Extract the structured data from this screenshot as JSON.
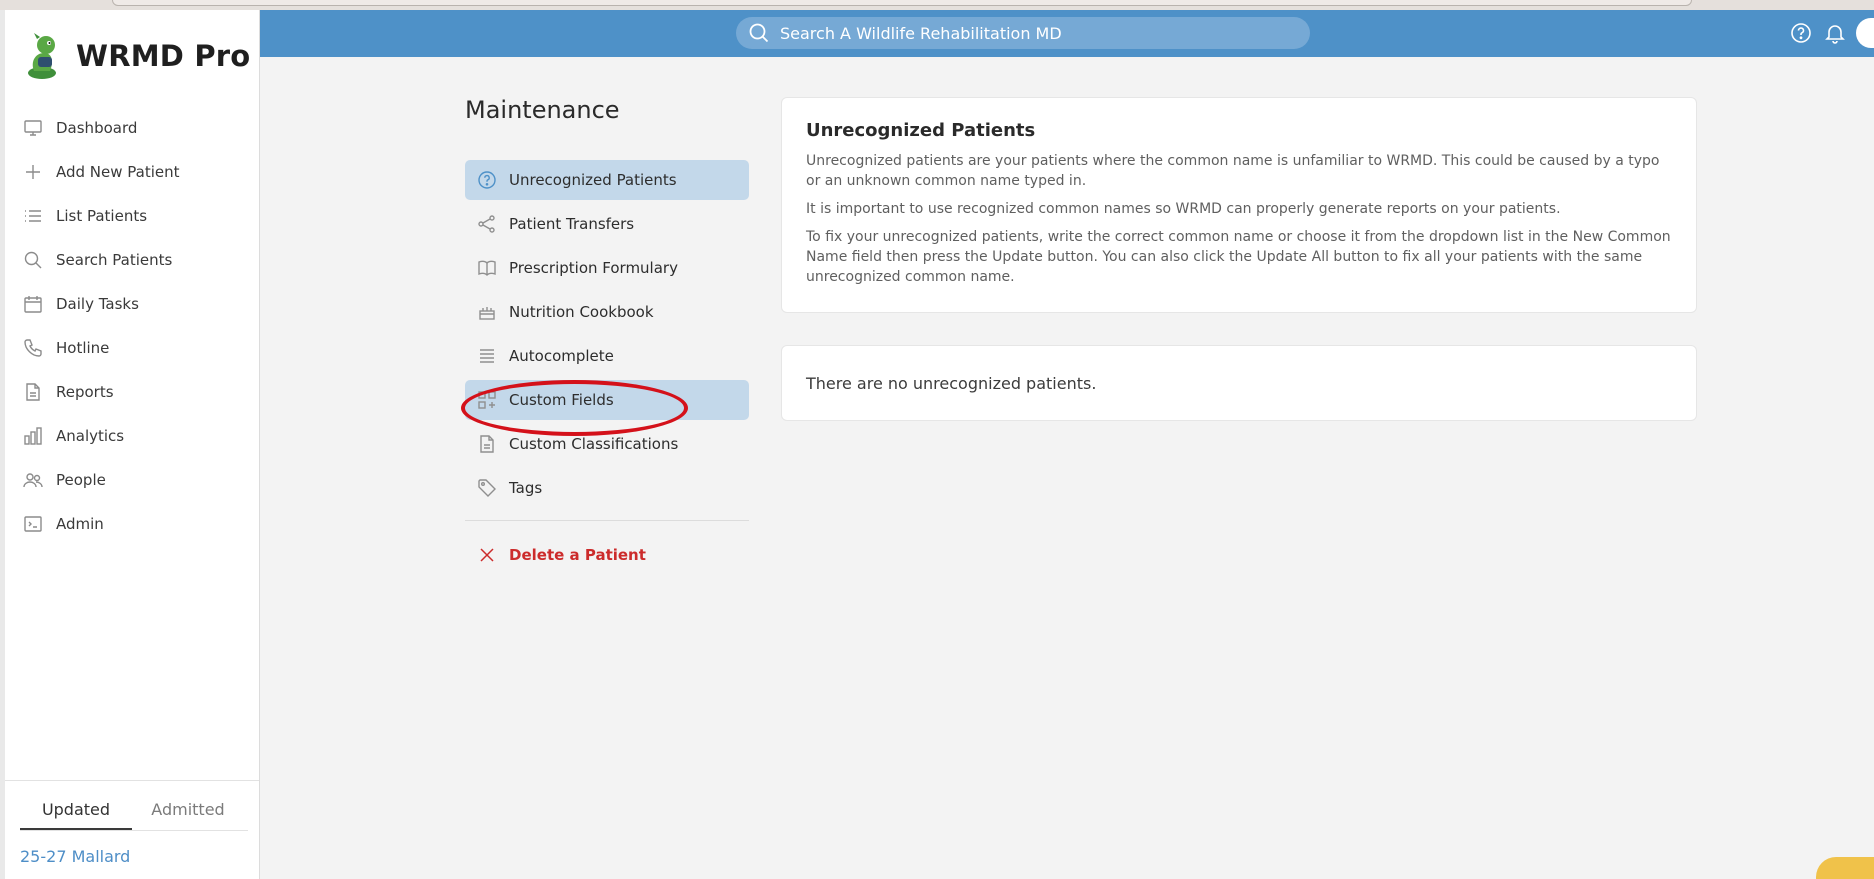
{
  "app": {
    "brand_name": "WRMD Pro",
    "accent_color": "#4e91c8",
    "danger_color": "#cc2b2b"
  },
  "sidebar": {
    "items": [
      {
        "label": "Dashboard",
        "icon": "monitor-icon"
      },
      {
        "label": "Add New Patient",
        "icon": "plus-icon"
      },
      {
        "label": "List Patients",
        "icon": "list-icon"
      },
      {
        "label": "Search Patients",
        "icon": "search-icon"
      },
      {
        "label": "Daily Tasks",
        "icon": "calendar-icon"
      },
      {
        "label": "Hotline",
        "icon": "phone-icon"
      },
      {
        "label": "Reports",
        "icon": "document-icon"
      },
      {
        "label": "Analytics",
        "icon": "bar-chart-icon"
      },
      {
        "label": "People",
        "icon": "people-icon"
      },
      {
        "label": "Admin",
        "icon": "terminal-icon"
      }
    ],
    "tabs": [
      {
        "label": "Updated",
        "active": true
      },
      {
        "label": "Admitted",
        "active": false
      }
    ],
    "recent_patient": "25-27 Mallard"
  },
  "header": {
    "search_placeholder": "Search A Wildlife Rehabilitation MD",
    "icons": [
      "help-icon",
      "bell-icon"
    ]
  },
  "maintenance": {
    "title": "Maintenance",
    "items": [
      {
        "label": "Unrecognized Patients",
        "icon": "question-circle-icon",
        "active": true
      },
      {
        "label": "Patient Transfers",
        "icon": "share-icon",
        "active": false
      },
      {
        "label": "Prescription Formulary",
        "icon": "book-icon",
        "active": false
      },
      {
        "label": "Nutrition Cookbook",
        "icon": "cake-icon",
        "active": false
      },
      {
        "label": "Autocomplete",
        "icon": "lines-icon",
        "active": false
      },
      {
        "label": "Custom Fields",
        "icon": "grid-plus-icon",
        "active": true
      },
      {
        "label": "Custom Classifications",
        "icon": "document-icon",
        "active": false
      },
      {
        "label": "Tags",
        "icon": "tag-icon",
        "active": false
      }
    ],
    "delete_label": "Delete a Patient"
  },
  "content": {
    "info_title": "Unrecognized Patients",
    "info_paragraphs": [
      "Unrecognized patients are your patients where the common name is unfamiliar to WRMD. This could be caused by a typo or an unknown common name typed in.",
      "It is important to use recognized common names so WRMD can properly generate reports on your patients.",
      "To fix your unrecognized patients, write the correct common name or choose it from the dropdown list in the New Common Name field then press the Update button. You can also click the Update All button to fix all your patients with the same unrecognized common name."
    ],
    "empty_message": "There are no unrecognized patients."
  }
}
